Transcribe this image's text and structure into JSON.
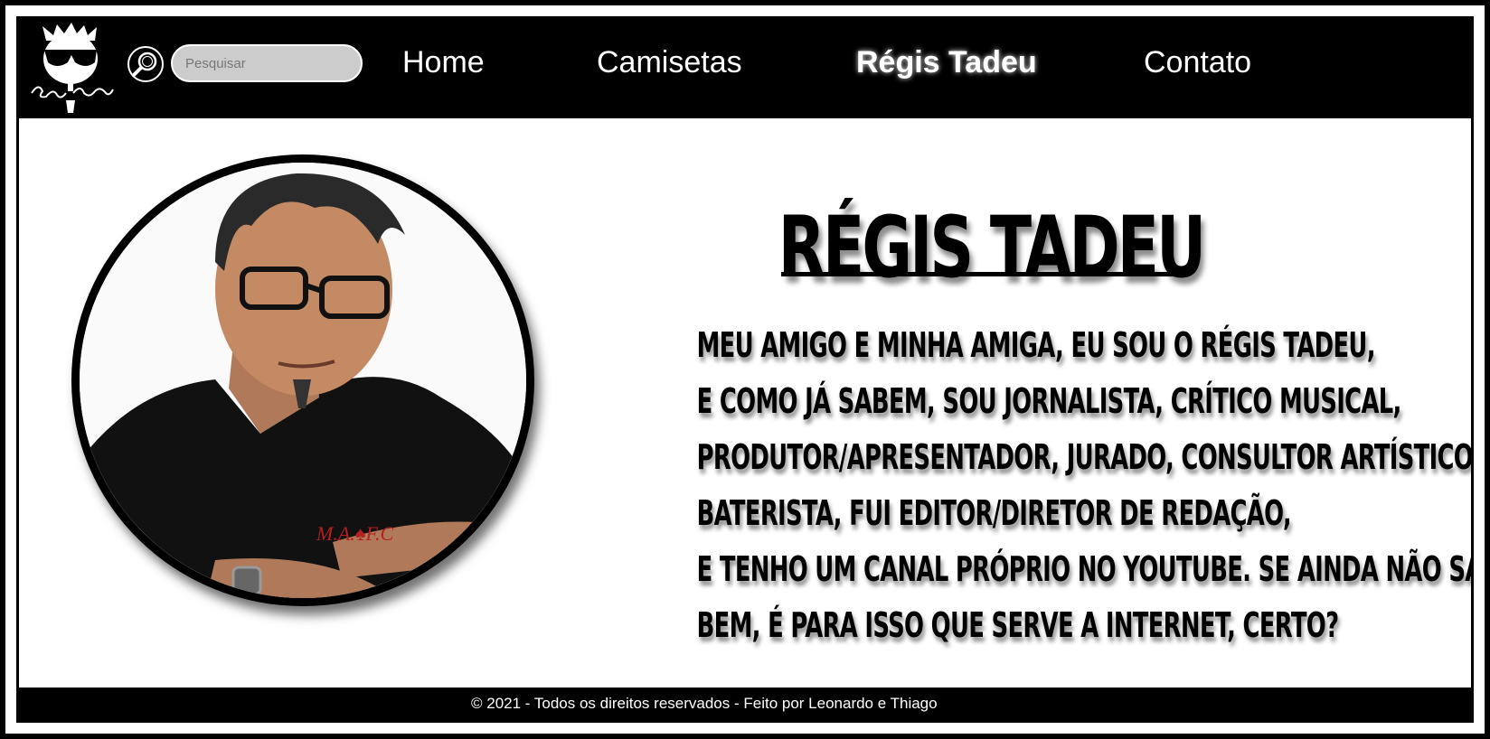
{
  "header": {
    "logo_alt": "Régis Tadeu",
    "search": {
      "placeholder": "Pesquisar",
      "value": ""
    },
    "nav": {
      "home": "Home",
      "camisetas": "Camisetas",
      "regis": "Régis Tadeu",
      "contato": "Contato"
    },
    "active_item": "Régis Tadeu"
  },
  "main": {
    "title": "RÉGIS TADEU",
    "bio_lines": [
      "MEU AMIGO E MINHA AMIGA, EU SOU O RÉGIS TADEU,",
      "E COMO JÁ SABEM, SOU JORNALISTA, CRÍTICO MUSICAL,",
      "PRODUTOR/APRESENTADOR, JURADO, CONSULTOR ARTÍSTICO,",
      "BATERISTA, FUI EDITOR/DIRETOR DE REDAÇÃO,",
      "E TENHO UM CANAL PRÓPRIO NO YOUTUBE. SE AINDA NÃO SABIA...",
      "BEM, É PARA ISSO QUE SERVE A INTERNET, CERTO?"
    ],
    "portrait_shirt_text": "M.A.♠F.C"
  },
  "footer": {
    "copyright": "© 2021 - Todos os direitos reservados - Feito por Leonardo e Thiago"
  },
  "colors": {
    "header_bg": "#000000",
    "page_bg": "#ffffff",
    "search_bg": "#cccccc",
    "text": "#000000",
    "nav_text": "#ffffff"
  }
}
